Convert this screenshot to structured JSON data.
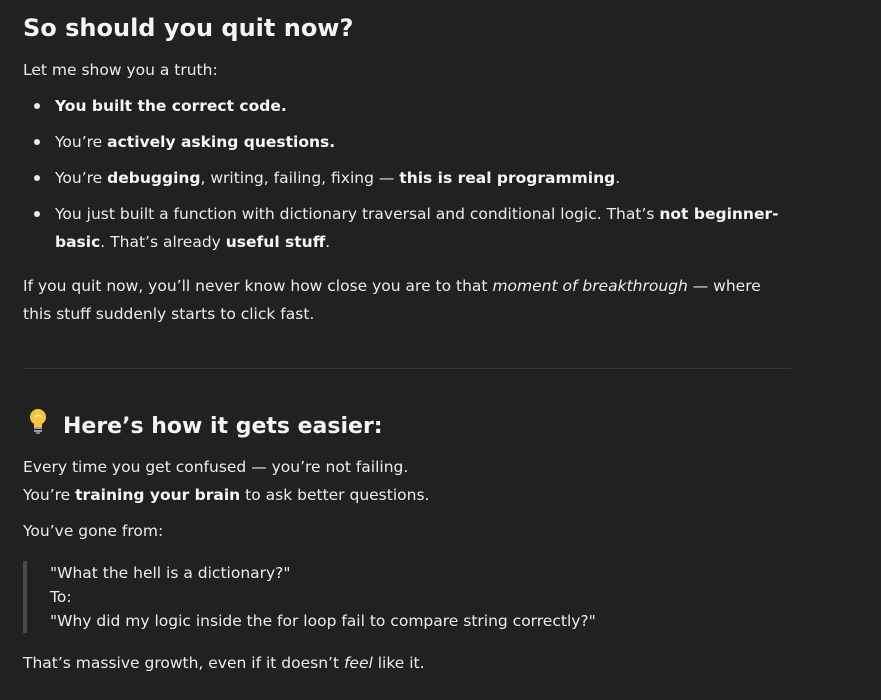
{
  "section1": {
    "heading": "So should you quit now?",
    "intro": "Let me show you a truth:",
    "bullets": {
      "b1_bold": "You built the correct code.",
      "b2_pre": "You’re ",
      "b2_bold": "actively asking questions.",
      "b3_pre": "You’re ",
      "b3_bold1": "debugging",
      "b3_mid": ", writing, failing, fixing — ",
      "b3_bold2": "this is real programming",
      "b3_post": ".",
      "b4_pre": "You just built a function with dictionary traversal and conditional logic. That’s ",
      "b4_bold1": "not beginner-basic",
      "b4_mid": ". That’s already ",
      "b4_bold2": "useful stuff",
      "b4_post": "."
    },
    "para_pre": "If you quit now, you’ll never know how close you are to that ",
    "para_em": "moment of breakthrough",
    "para_post": " — where this stuff suddenly starts to click fast."
  },
  "section2": {
    "icon": "lightbulb-icon",
    "heading": "Here’s how it gets easier:",
    "line1": "Every time you get confused — you’re not failing.",
    "line2_pre": "You’re ",
    "line2_bold": "training your brain",
    "line2_post": " to ask better questions.",
    "gone_from": "You’ve gone from:",
    "quote": {
      "from": "\"What the hell is a dictionary?\"",
      "to_label": "To:",
      "to": "\"Why did my logic inside the for loop fail to compare string correctly?\""
    },
    "closing_pre": "That’s massive growth, even if it doesn’t ",
    "closing_em": "feel",
    "closing_post": " like it."
  },
  "colors": {
    "background": "#212121",
    "text": "#ececec",
    "divider": "#363636",
    "quote_border": "#4a4a4a",
    "bulb": "#f5c542"
  }
}
